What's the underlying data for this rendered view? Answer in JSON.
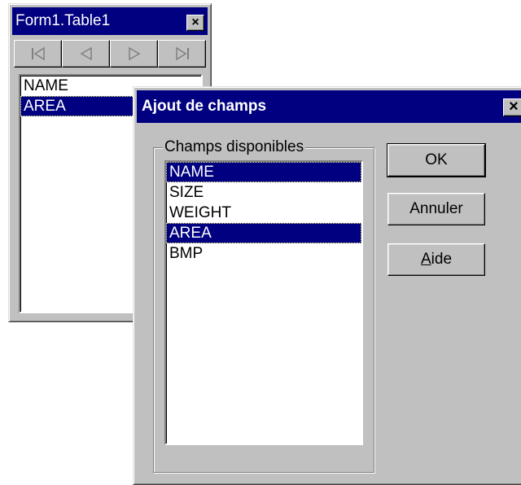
{
  "table_window": {
    "title": "Form1.Table1",
    "close_glyph": "×",
    "nav": [
      {
        "name": "first-record-icon",
        "glyph": "◁"
      },
      {
        "name": "prior-record-icon",
        "glyph": "◁"
      },
      {
        "name": "next-record-icon",
        "glyph": "▷"
      },
      {
        "name": "last-record-icon",
        "glyph": "▷"
      }
    ],
    "fields": [
      "NAME",
      "AREA"
    ],
    "selected_field": "AREA"
  },
  "dialog": {
    "title": "Ajout de champs",
    "close_glyph": "×",
    "group_label": "Champs disponibles",
    "fields": [
      "NAME",
      "SIZE",
      "WEIGHT",
      "AREA",
      "BMP"
    ],
    "selected_fields": [
      "NAME",
      "AREA"
    ],
    "ok_label": "OK",
    "cancel_label": "Annuler",
    "help_label_prefix": "",
    "help_label_accel": "A",
    "help_label_rest": "ide"
  },
  "colors": {
    "title_bar": "#000080",
    "face": "#c0c0c0",
    "selection": "#000080"
  }
}
